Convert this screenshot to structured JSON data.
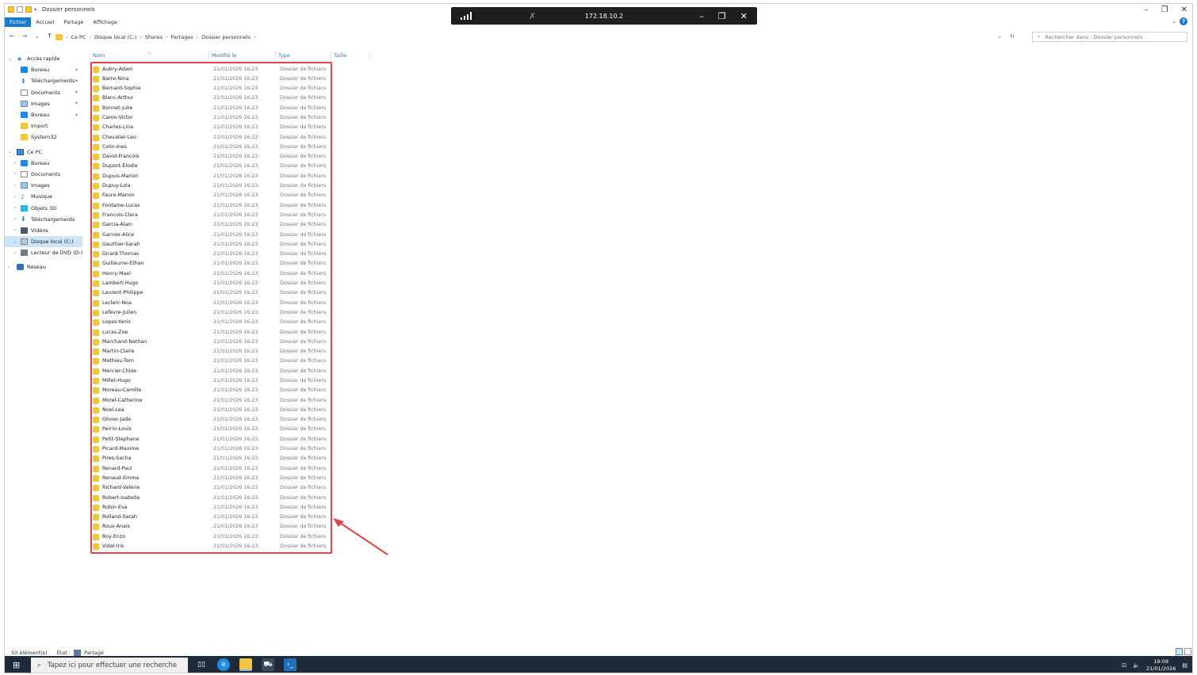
{
  "window": {
    "title": "Dossier personnels",
    "ribbon_tabs": [
      "Fichier",
      "Accueil",
      "Partage",
      "Affichage"
    ]
  },
  "remote_bar": {
    "ip": "172.18.10.2"
  },
  "address": {
    "crumbs": [
      "Ce PC",
      "Disque local (C:)",
      "Shares",
      "Partages",
      "Dossier personnels"
    ],
    "search_placeholder": "Rechercher dans : Dossier personnels"
  },
  "nav": {
    "quick_access": "Accès rapide",
    "quick_items": [
      {
        "label": "Bureau",
        "icon": "desktop-icon"
      },
      {
        "label": "Téléchargements",
        "icon": "download-icon"
      },
      {
        "label": "Documents",
        "icon": "document-icon"
      },
      {
        "label": "Images",
        "icon": "image-icon"
      },
      {
        "label": "Bureau",
        "icon": "desktop-icon"
      },
      {
        "label": "Import",
        "icon": "folder-icon"
      },
      {
        "label": "System32",
        "icon": "folder-icon"
      }
    ],
    "this_pc": "Ce PC",
    "pc_items": [
      {
        "label": "Bureau",
        "icon": "desktop-icon"
      },
      {
        "label": "Documents",
        "icon": "document-icon"
      },
      {
        "label": "Images",
        "icon": "image-icon"
      },
      {
        "label": "Musique",
        "icon": "music-icon"
      },
      {
        "label": "Objets 3D",
        "icon": "cube-icon"
      },
      {
        "label": "Téléchargements",
        "icon": "download-icon"
      },
      {
        "label": "Vidéos",
        "icon": "video-icon"
      },
      {
        "label": "Disque local (C:)",
        "icon": "drive-icon"
      },
      {
        "label": "Lecteur de DVD (D:)",
        "icon": "dvd-icon"
      }
    ],
    "network": "Réseau"
  },
  "columns": {
    "name": "Nom",
    "modified": "Modifié le",
    "type": "Type",
    "size": "Taille"
  },
  "files": [
    "Aubry-Adam",
    "Barre-Nina",
    "Bernard-Sophie",
    "Blanc-Arthur",
    "Bonnet-Julie",
    "Caron-Victor",
    "Charles-Lina",
    "Chevalier-Leo",
    "Colin-Ines",
    "David-Francois",
    "Dupont-Elodie",
    "Dupuis-Marion",
    "Dupuy-Lola",
    "Faure-Manon",
    "Fontaine-Lucas",
    "Francois-Clara",
    "Garcia-Alain",
    "Garnier-Alice",
    "Gauthier-Sarah",
    "Girard-Thomas",
    "Guillaume-Ethan",
    "Henry-Mael",
    "Lambert-Hugo",
    "Laurent-Philippe",
    "Leclerc-Noa",
    "Lefevre-Julien",
    "Lopes-Yanis",
    "Lucas-Zoe",
    "Marchand-Nathan",
    "Martin-Claire",
    "Mathieu-Tom",
    "Mercier-Chloe",
    "Millet-Hugo",
    "Moreau-Camille",
    "Morel-Catherine",
    "Noel-Lea",
    "Olivier-Jade",
    "Perrin-Louis",
    "Petit-Stephane",
    "Picard-Maxime",
    "Pires-Sacha",
    "Renard-Paul",
    "Renaud-Emma",
    "Richard-Valerie",
    "Robert-Isabelle",
    "Robin-Eva",
    "Rolland-Sarah",
    "Roux-Anais",
    "Roy-Enzo",
    "Vidal-Iris"
  ],
  "file_date": "21/01/2026 16:23",
  "file_type": "Dossier de fichiers",
  "status": {
    "count": "50 élément(s)",
    "state_label": "État :",
    "state_value": "Partagé"
  },
  "taskbar": {
    "search_placeholder": "Tapez ici pour effectuer une recherche",
    "time": "19:09",
    "date": "21/01/2026"
  },
  "colors": {
    "accent": "#1979ca",
    "highlight_box": "#e0464a",
    "folder": "#f5c542",
    "taskbar": "#1f2b3a"
  }
}
